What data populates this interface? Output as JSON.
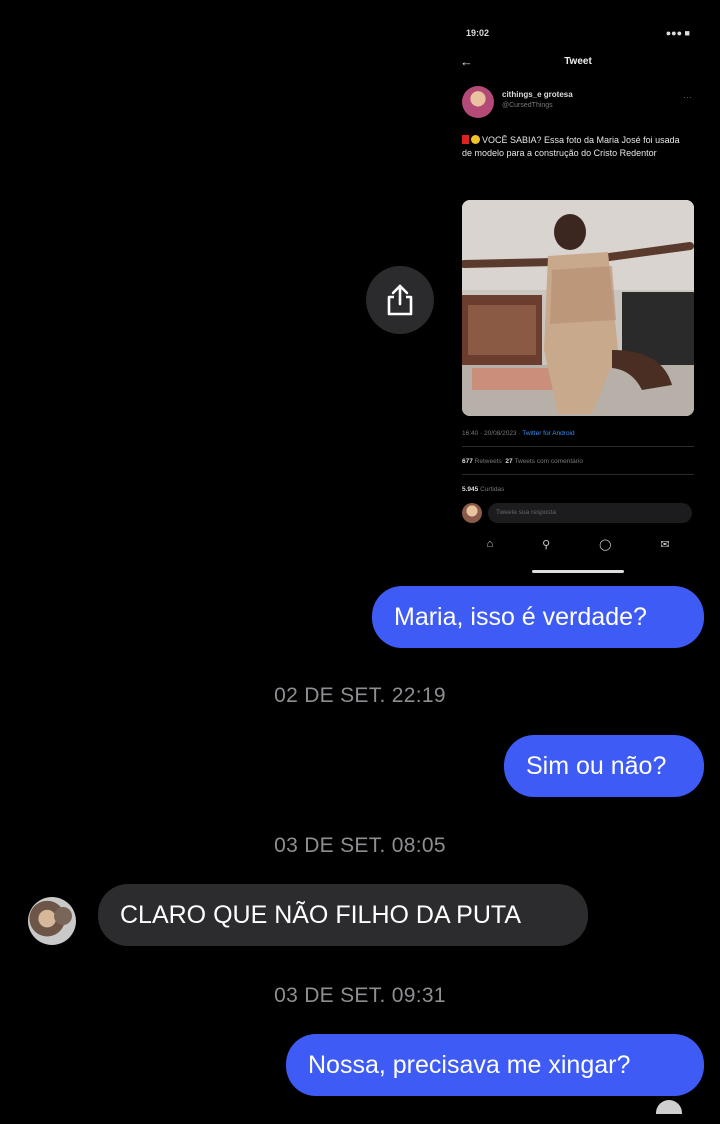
{
  "tweet": {
    "status_time": "19:02",
    "status_right": "●●● ■",
    "back": "←",
    "header": "Tweet",
    "author_name": "cithings_e grotesa",
    "author_handle": "@CursedThings",
    "more": "…",
    "text": "VOCÊ SABIA? Essa foto da Maria José foi usada de modelo para a construção do Cristo Redentor",
    "timestamp": "16:40 · 20/08/2023 · ",
    "client": "Twitter for Android",
    "retweets_count": "677",
    "retweets_label": "Retweets",
    "quotes_count": "27",
    "quotes_label": "Tweets com comentário",
    "likes_count": "5.945",
    "likes_label": "Curtidas",
    "reply_placeholder": "Tweete sua resposta",
    "nav_icons": [
      "home-icon",
      "search-icon",
      "bell-icon",
      "mail-icon"
    ]
  },
  "messages": [
    {
      "type": "outgoing",
      "text": "Maria, isso é verdade?"
    },
    {
      "type": "timestamp",
      "text": "02 DE SET. 22:19"
    },
    {
      "type": "outgoing",
      "text": "Sim ou não?"
    },
    {
      "type": "timestamp",
      "text": "03 DE SET. 08:05"
    },
    {
      "type": "incoming",
      "text": "CLARO QUE NÃO FILHO DA PUTA"
    },
    {
      "type": "timestamp",
      "text": "03 DE SET. 09:31"
    },
    {
      "type": "outgoing",
      "text": "Nossa, precisava me xingar?"
    }
  ],
  "colors": {
    "background": "#000000",
    "outgoing_bubble": "#3e5bf5",
    "incoming_bubble": "#2c2c2e",
    "timestamp_text": "#8e8e93",
    "share_button": "#2b2b2d"
  }
}
